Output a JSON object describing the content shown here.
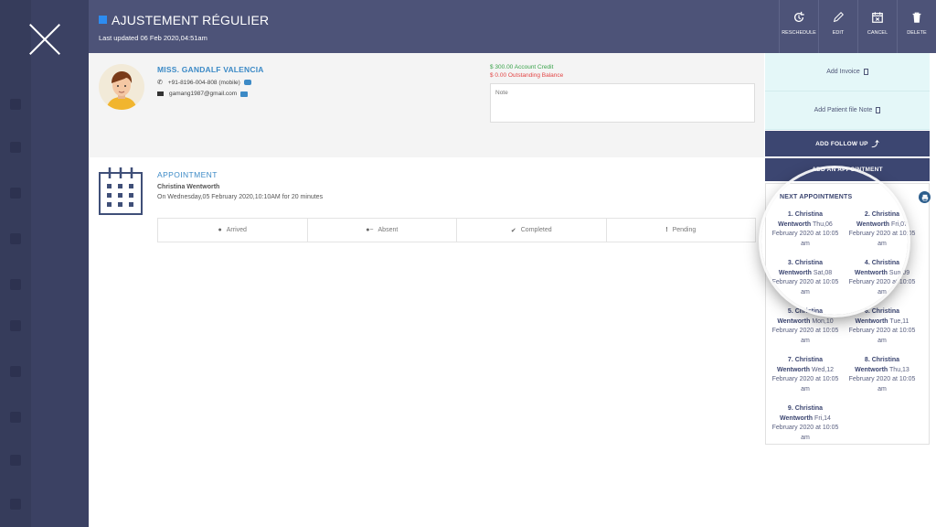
{
  "header": {
    "title": "AJUSTEMENT RÉGULIER",
    "last_updated": "Last updated 06 Feb 2020,04:51am",
    "actions": [
      {
        "label": "RESCHEDULE",
        "icon": "reschedule-icon"
      },
      {
        "label": "EDIT",
        "icon": "pencil-icon"
      },
      {
        "label": "CANCEL",
        "icon": "calendar-cancel-icon"
      },
      {
        "label": "DELETE",
        "icon": "trash-icon"
      }
    ]
  },
  "patient": {
    "name": "MISS. GANDALF VALENCIA",
    "phone": "+91-8196-004-808 (mobile)",
    "email": "gamang1987@gmail.com",
    "account_credit": "$ 300.00 Account Credit",
    "outstanding_balance": "$ 0.00 Outstanding Balance",
    "note_placeholder": "Note"
  },
  "appointment": {
    "heading": "APPOINTMENT",
    "practitioner": "Christina Wentworth",
    "when": "On Wednesday,05 February 2020,10:10AM for 20 minutes",
    "statuses": [
      {
        "label": "Arrived",
        "icon": "person-icon",
        "glyph": "👤"
      },
      {
        "label": "Absent",
        "icon": "person-remove-icon",
        "glyph": "👥"
      },
      {
        "label": "Completed",
        "icon": "check-icon",
        "glyph": "✔"
      },
      {
        "label": "Pending",
        "icon": "exclamation-icon",
        "glyph": "!"
      }
    ]
  },
  "right_panel": {
    "add_invoice": "Add Invoice",
    "add_file_note": "Add Patient file Note",
    "add_follow_up": "ADD FOLLOW UP",
    "add_appointment": "ADD AN APPOINTMENT",
    "next_title": "NEXT APPOINTMENTS",
    "next_appointments": [
      {
        "num": "1.",
        "name_a": "Christina",
        "name_b": "Wentworth",
        "day": "Thu,06",
        "rest": "February 2020 at 10:05",
        "ampm": "am"
      },
      {
        "num": "2.",
        "name_a": "Christina",
        "name_b": "Wentworth",
        "day": "Fri,07",
        "rest": "February 2020 at 10:05",
        "ampm": "am"
      },
      {
        "num": "3.",
        "name_a": "Christina",
        "name_b": "Wentworth",
        "day": "Sat,08",
        "rest": "February 2020 at 10:05",
        "ampm": "am"
      },
      {
        "num": "4.",
        "name_a": "Christina",
        "name_b": "Wentworth",
        "day": "Sun,09",
        "rest": "February 2020 at 10:05",
        "ampm": "am"
      },
      {
        "num": "5.",
        "name_a": "Christina",
        "name_b": "Wentworth",
        "day": "Mon,10",
        "rest": "February 2020 at 10:05",
        "ampm": "am"
      },
      {
        "num": "6.",
        "name_a": "Christina",
        "name_b": "Wentworth",
        "day": "Tue,11",
        "rest": "February 2020 at 10:05",
        "ampm": "am"
      },
      {
        "num": "7.",
        "name_a": "Christina",
        "name_b": "Wentworth",
        "day": "Wed,12",
        "rest": "February 2020 at 10:05",
        "ampm": "am"
      },
      {
        "num": "8.",
        "name_a": "Christina",
        "name_b": "Wentworth",
        "day": "Thu,13",
        "rest": "February 2020 at 10:05",
        "ampm": "am"
      },
      {
        "num": "9.",
        "name_a": "Christina",
        "name_b": "Wentworth",
        "day": "Fri,14",
        "rest": "February 2020 at 10:05",
        "ampm": "am"
      }
    ]
  },
  "colors": {
    "header_bg": "#4d5378",
    "accent_blue": "#3c8ac6",
    "credit_green": "#3aa34b",
    "balance_red": "#e34545",
    "dark_button": "#3c4671",
    "light_button": "#e4f7f8"
  }
}
